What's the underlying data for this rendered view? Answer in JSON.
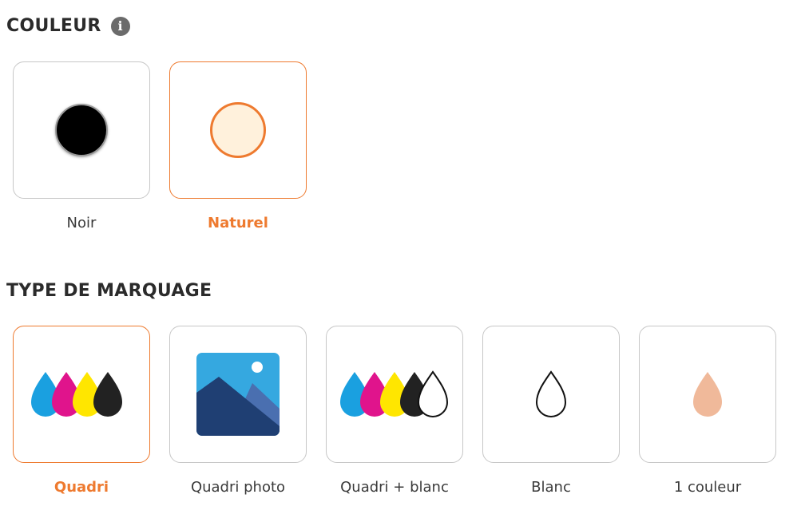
{
  "couleur": {
    "title": "COULEUR",
    "info_icon_glyph": "i",
    "options": [
      {
        "label": "Noir",
        "swatch_color": "#000000",
        "selected": false
      },
      {
        "label": "Naturel",
        "swatch_color": "#fff1dc",
        "selected": true
      }
    ]
  },
  "marquage": {
    "title": "TYPE DE MARQUAGE",
    "options": [
      {
        "label": "Quadri",
        "icon": "cmyk-drops-icon",
        "selected": true
      },
      {
        "label": "Quadri photo",
        "icon": "photo-icon",
        "selected": false
      },
      {
        "label": "Quadri + blanc",
        "icon": "cmyk-white-drops-icon",
        "selected": false
      },
      {
        "label": "Blanc",
        "icon": "white-drop-icon",
        "selected": false
      },
      {
        "label": "1 couleur",
        "icon": "single-color-drop-icon",
        "selected": false
      }
    ]
  },
  "colors": {
    "accent": "#ee7a2f",
    "cyan": "#1aa0e0",
    "magenta": "#e0148c",
    "yellow": "#ffe600",
    "black": "#222222",
    "single_color": "#f0b99a"
  }
}
